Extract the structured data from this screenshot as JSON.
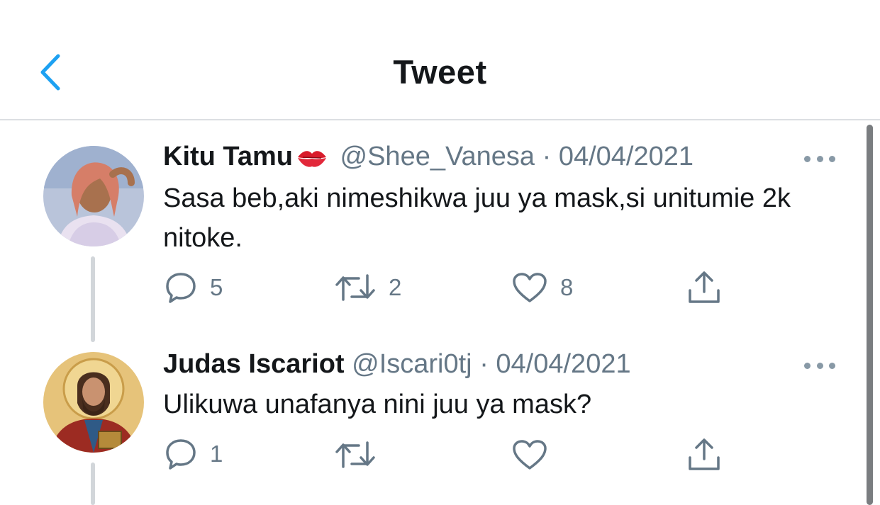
{
  "header": {
    "title": "Tweet",
    "back_icon": "chevron-left-icon"
  },
  "colors": {
    "accent": "#1da1f2",
    "secondary_text": "#657786",
    "divider": "#dcdfe2"
  },
  "tweets": [
    {
      "name": "Kitu Tamu",
      "name_emoji": "kiss-mark-emoji",
      "handle": "@Shee_Vanesa",
      "separator": "·",
      "date": "04/04/2021",
      "text": "Sasa beb,aki nimeshikwa juu ya mask,si unitumie 2k nitoke.",
      "actions": {
        "replies": "5",
        "retweets": "2",
        "likes": "8"
      }
    },
    {
      "name": "Judas Iscariot",
      "handle": "@Iscari0tj",
      "separator": "·",
      "date": "04/04/2021",
      "text": "Ulikuwa unafanya nini juu ya mask?",
      "actions": {
        "replies": "1",
        "retweets": "",
        "likes": ""
      }
    }
  ]
}
